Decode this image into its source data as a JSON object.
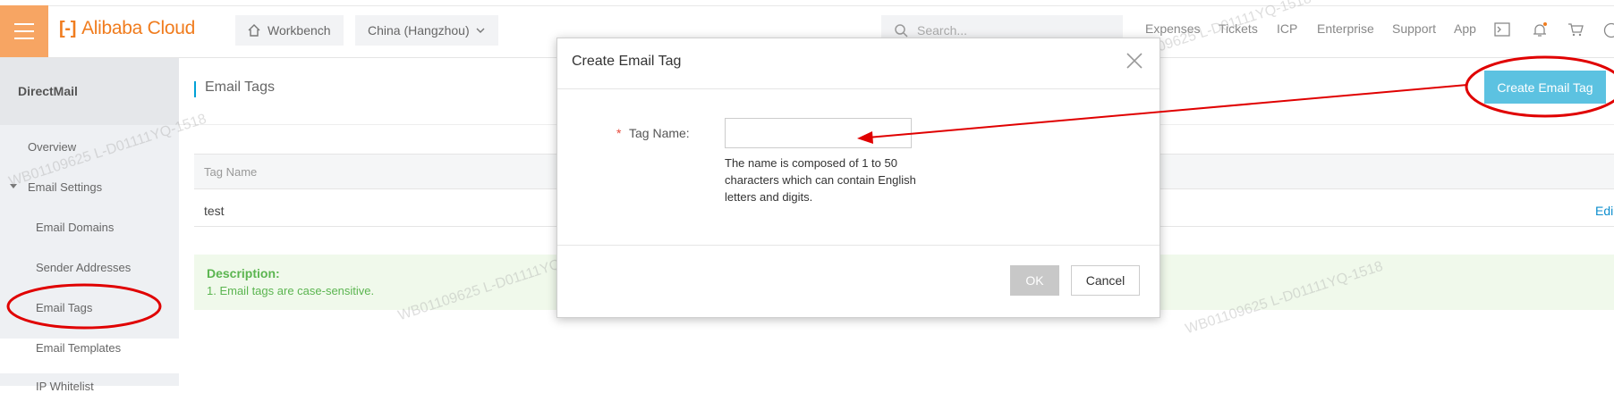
{
  "brand": {
    "name": "Alibaba Cloud",
    "accent": "#f07c1e"
  },
  "topbar": {
    "workbench": "Workbench",
    "region": "China (Hangzhou)",
    "search_placeholder": "Search...",
    "links": [
      "Expenses",
      "Tickets",
      "ICP",
      "Enterprise",
      "Support",
      "App"
    ]
  },
  "sidebar": {
    "title": "DirectMail",
    "items": [
      {
        "label": "Overview"
      },
      {
        "label": "Email Settings"
      },
      {
        "label": "Email Domains"
      },
      {
        "label": "Sender Addresses"
      },
      {
        "label": "Email Tags"
      },
      {
        "label": "Email Templates"
      },
      {
        "label": "IP Whitelist"
      }
    ]
  },
  "main": {
    "title": "Email Tags",
    "create_button": "Create Email Tag",
    "table": {
      "column": "Tag Name",
      "rows": [
        {
          "name": "test",
          "action": "Edi"
        }
      ]
    },
    "description": {
      "title": "Description:",
      "line": "1. Email tags are case-sensitive."
    }
  },
  "modal": {
    "title": "Create Email Tag",
    "required_mark": "*",
    "field_label": "Tag Name:",
    "field_value": "",
    "hint": "The name is composed of 1 to 50 characters which can contain English letters and digits.",
    "ok": "OK",
    "cancel": "Cancel"
  },
  "watermark": "WB01109625 L-D01111YQ-1518",
  "annotation_color": "#e00000"
}
